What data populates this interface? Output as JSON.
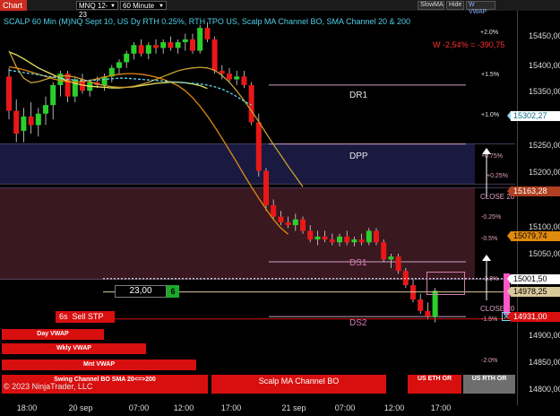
{
  "toolbar": {
    "tab_label": "Chart",
    "instrument": "MNQ 12-23",
    "interval": "60 Minute",
    "buttons": [
      "SlowMA",
      "Hide",
      "W VWAP"
    ]
  },
  "chart": {
    "title": "SCALP 60 Min (M)NQ Sept 10, US Dy RTH 0.25%, RTH TPO US, Scalp MA Channel BO, SMA Channel 20 & 200",
    "change_text": "W -2,54% = -390,75",
    "copyright": "© 2023 NinjaTrader, LLC",
    "levels": [
      "DR1",
      "DPP",
      "DS1",
      "DS2"
    ],
    "close_labels": [
      "CLOSE 20",
      "CLOSE 20"
    ],
    "pct_labels": [
      "+2.0%",
      "+1.5%",
      "+1.0%",
      "+0.75%",
      "+0.25%",
      "-0.25%",
      "-0.5%",
      "-1.0%",
      "-1.5%",
      "-2.0%"
    ],
    "qty_value": "23,00",
    "qty_counter": "6",
    "order_label": "6s  Sell STP",
    "buttons": [
      "Day VWAP",
      "Wkly VWAP",
      "Mnt VWAP",
      "Swing Channel BO SMA 20<=>200",
      "Scalp MA Channel BO",
      "US ETH OR",
      "US RTH OR"
    ]
  },
  "price_axis": {
    "labels": [
      "15450,00",
      "15400,00",
      "15350,00",
      "15250,00",
      "15200,00",
      "15100,00",
      "15050,00",
      "14900,00",
      "14850,00",
      "14800,00"
    ],
    "tags": [
      {
        "text": "15302,27",
        "bg": "#ffffff",
        "fg": "#0a6b8a",
        "border": "#8ed8ee"
      },
      {
        "text": "15163,28",
        "bg": "#b04020",
        "fg": "#ffffff",
        "border": "#b04020"
      },
      {
        "text": "15079,74",
        "bg": "#e08a10",
        "fg": "#000000",
        "border": "#e08a10"
      },
      {
        "text": "15001,50",
        "bg": "#ffffff",
        "fg": "#000000",
        "border": "#ffffff"
      },
      {
        "text": "14978,25",
        "bg": "#d8c89a",
        "fg": "#000000",
        "border": "#d8c89a"
      },
      {
        "text": "14931,00",
        "bg": "#d80f0f",
        "fg": "#ffffff",
        "border": "#d80f0f"
      }
    ]
  },
  "time_axis": {
    "labels": [
      "18:00",
      "20 sep",
      "07:00",
      "12:00",
      "17:00",
      "21 sep",
      "07:00",
      "12:00",
      "17:00"
    ]
  },
  "chart_data": {
    "type": "candlestick",
    "title": "SCALP 60 Min (M)NQ Sept 10, US Dy RTH 0.25%, RTH TPO US, Scalp MA Channel BO, SMA Channel 20 & 200",
    "instrument": "MNQ 12-23",
    "interval": "60 Minute",
    "ylim": [
      14780,
      15470
    ],
    "y_ticks": [
      15450,
      15400,
      15350,
      15300,
      15250,
      15200,
      15150,
      15100,
      15050,
      15000,
      14950,
      14900,
      14850,
      14800
    ],
    "x_ticks": [
      "18:00",
      "20 sep",
      "07:00",
      "12:00",
      "17:00",
      "21 sep",
      "07:00",
      "12:00",
      "17:00"
    ],
    "candles": [
      [
        15355,
        15370,
        15280,
        15295
      ],
      [
        15295,
        15315,
        15240,
        15255
      ],
      [
        15260,
        15300,
        15240,
        15285
      ],
      [
        15285,
        15310,
        15255,
        15270
      ],
      [
        15270,
        15300,
        15250,
        15290
      ],
      [
        15290,
        15320,
        15270,
        15305
      ],
      [
        15305,
        15345,
        15280,
        15340
      ],
      [
        15340,
        15365,
        15320,
        15360
      ],
      [
        15360,
        15365,
        15310,
        15320
      ],
      [
        15320,
        15355,
        15310,
        15350
      ],
      [
        15350,
        15360,
        15325,
        15330
      ],
      [
        15330,
        15350,
        15320,
        15345
      ],
      [
        15345,
        15355,
        15335,
        15340
      ],
      [
        15340,
        15360,
        15330,
        15355
      ],
      [
        15355,
        15375,
        15345,
        15370
      ],
      [
        15370,
        15385,
        15360,
        15380
      ],
      [
        15380,
        15400,
        15370,
        15395
      ],
      [
        15395,
        15415,
        15385,
        15410
      ],
      [
        15410,
        15420,
        15390,
        15395
      ],
      [
        15395,
        15415,
        15385,
        15410
      ],
      [
        15410,
        15420,
        15395,
        15405
      ],
      [
        15405,
        15420,
        15395,
        15415
      ],
      [
        15415,
        15425,
        15400,
        15405
      ],
      [
        15405,
        15420,
        15395,
        15415
      ],
      [
        15415,
        15430,
        15400,
        15420
      ],
      [
        15420,
        15430,
        15395,
        15400
      ],
      [
        15400,
        15445,
        15395,
        15440
      ],
      [
        15440,
        15450,
        15415,
        15420
      ],
      [
        15420,
        15425,
        15360,
        15365
      ],
      [
        15365,
        15375,
        15350,
        15360
      ],
      [
        15360,
        15370,
        15345,
        15350
      ],
      [
        15350,
        15365,
        15340,
        15355
      ],
      [
        15355,
        15365,
        15335,
        15340
      ],
      [
        15340,
        15345,
        15270,
        15275
      ],
      [
        15275,
        15290,
        15180,
        15190
      ],
      [
        15190,
        15195,
        15120,
        15130
      ],
      [
        15130,
        15140,
        15105,
        15110
      ],
      [
        15110,
        15120,
        15095,
        15100
      ],
      [
        15100,
        15110,
        15090,
        15095
      ],
      [
        15095,
        15115,
        15085,
        15105
      ],
      [
        15105,
        15110,
        15080,
        15085
      ],
      [
        15085,
        15095,
        15065,
        15070
      ],
      [
        15070,
        15085,
        15060,
        15075
      ],
      [
        15075,
        15085,
        15065,
        15070
      ],
      [
        15070,
        15080,
        15060,
        15065
      ],
      [
        15065,
        15080,
        15058,
        15075
      ],
      [
        15075,
        15085,
        15060,
        15065
      ],
      [
        15065,
        15075,
        15058,
        15070
      ],
      [
        15070,
        15080,
        15060,
        15065
      ],
      [
        15065,
        15090,
        15060,
        15085
      ],
      [
        15085,
        15090,
        15060,
        15065
      ],
      [
        15065,
        15070,
        15030,
        15035
      ],
      [
        15035,
        15045,
        15020,
        15040
      ],
      [
        15040,
        15045,
        15010,
        15015
      ],
      [
        15015,
        15020,
        14985,
        14990
      ],
      [
        14990,
        15000,
        14960,
        14965
      ],
      [
        14965,
        14975,
        14940,
        14945
      ],
      [
        14945,
        14960,
        14930,
        14935
      ],
      [
        14935,
        14985,
        14925,
        14980
      ]
    ],
    "series": [
      {
        "name": "Scalp MA Channel BO",
        "color": "#e8e060",
        "values": [
          15398,
          15393,
          15386,
          15378,
          15370,
          15364,
          15358,
          15352,
          15347,
          15343,
          15340,
          15338,
          15337,
          15336,
          15335,
          15335,
          15336,
          15337,
          15339,
          15341,
          15343,
          15344,
          15345,
          15345,
          15344,
          15342,
          15339,
          15334
        ]
      },
      {
        "name": "SMA Channel 20 & 200",
        "color": "#c8a030",
        "values": [
          15400,
          15372,
          15352,
          15344,
          15346,
          15350,
          15354,
          15356,
          15356,
          15354,
          15350,
          15346,
          15342,
          15339,
          15337,
          15336,
          15336,
          15338,
          15341,
          15345,
          15350,
          15355,
          15360,
          15365,
          15368,
          15370,
          15371,
          15370,
          15366,
          15357,
          15345,
          15330,
          15313,
          15295,
          15276,
          15256,
          15236,
          15217,
          15198,
          15180,
          15162
        ]
      },
      {
        "name": "SMA Channel 20 & 200",
        "color": "#e08a10",
        "values": [
          15372,
          15370,
          15367,
          15363,
          15359,
          15355,
          15351,
          15348,
          15346,
          15345,
          15346,
          15348,
          15351,
          15354,
          15357,
          15359,
          15360,
          15360,
          15359,
          15357,
          15354,
          15350,
          15345,
          15339,
          15330,
          15318,
          15303,
          15286,
          15267,
          15247,
          15226,
          15205,
          15183,
          15162,
          15142,
          15123,
          15105,
          15090,
          15079
        ]
      },
      {
        "name": "VWAP",
        "color": "#5ed8ec",
        "values": [
          15366,
          15364,
          15362,
          15360,
          15358,
          15356,
          15354,
          15352,
          15350,
          15349,
          15348,
          15348,
          15349,
          15350,
          15351,
          15352,
          15352,
          15351,
          15350,
          15349,
          15348,
          15347,
          15346,
          15345,
          15344,
          15343,
          15342,
          15340,
          15337,
          15333,
          15327,
          15320,
          15312,
          15305
        ]
      }
    ],
    "levels": [
      {
        "name": "DR1",
        "value": 15340
      },
      {
        "name": "DPP",
        "value": 15237
      },
      {
        "name": "DS1",
        "value": 15031
      },
      {
        "name": "DS2",
        "value": 14935
      }
    ],
    "zones": [
      {
        "from": 15237,
        "to": 15167,
        "color": "#1a1a40"
      },
      {
        "from": 15160,
        "to": 15000,
        "color": "#3a1820"
      }
    ],
    "horizontal_lines": [
      15001.5,
      14978.25,
      14931
    ]
  }
}
